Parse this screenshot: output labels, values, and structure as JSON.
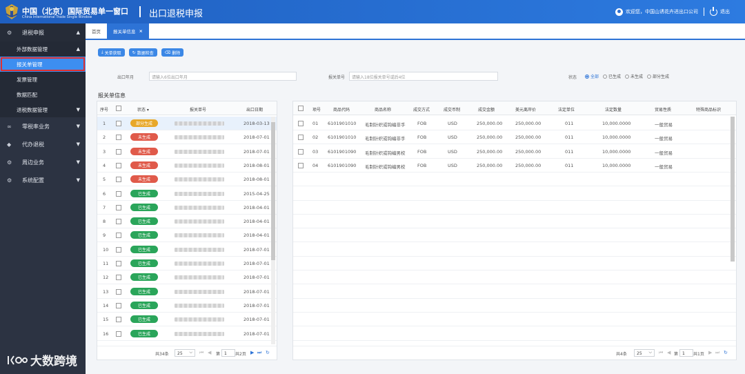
{
  "header": {
    "brand_cn": "中国（北京）国际贸易单一窗口",
    "brand_en": "China International Trade Single Window",
    "title": "出口退税申报",
    "welcome": "欢迎您，中国山诱花卉进出口公司",
    "logout": "退出"
  },
  "sidebar": {
    "items": [
      {
        "label": "退税申报",
        "icon": "gear-icon",
        "glyph": "⚙",
        "caret": "▲"
      },
      {
        "label": "零税率业务",
        "icon": "link-icon",
        "glyph": "∞",
        "caret": "▼"
      },
      {
        "label": "代办退税",
        "icon": "layers-icon",
        "glyph": "◆",
        "caret": "▼"
      },
      {
        "label": "周边业务",
        "icon": "gear-icon",
        "glyph": "⚙",
        "caret": "▼"
      },
      {
        "label": "系统配置",
        "icon": "gear-icon",
        "glyph": "⚙",
        "caret": "▼"
      }
    ],
    "sub": {
      "group": "外部数据管理",
      "group_caret": "▲",
      "children": [
        "报关单管理",
        "发票管理",
        "数据匹配"
      ],
      "group2": "退税数据管理",
      "group2_caret": "▼"
    },
    "watermark": "大数跨境"
  },
  "tabs": [
    {
      "label": "首页"
    },
    {
      "label": "报关单信息",
      "close": "×"
    }
  ],
  "toolbar": {
    "buttons": [
      {
        "glyph": "⤓",
        "label": "关单获取"
      },
      {
        "glyph": "↻",
        "label": "数据检查"
      },
      {
        "glyph": "⌫",
        "label": "删除"
      }
    ]
  },
  "filters": {
    "export_month_label": "出口年月",
    "export_month_placeholder": "请输入6位出口年月",
    "decl_no_label": "报关单号",
    "decl_no_placeholder": "请输入18位报关单号或后4位",
    "status_label": "状态",
    "status_options": [
      "全部",
      "已生成",
      "未生成",
      "部分生成"
    ],
    "status_selected": "全部"
  },
  "section_title": "报关单信息",
  "colors": {
    "partial": "#e8a82a",
    "ungenerated": "#e05a4a",
    "generated": "#2aa55a"
  },
  "left_table": {
    "headers": {
      "seq": "序号",
      "status": "状态 ▾",
      "decl_no": "报关单号",
      "export_date": "出口日期"
    },
    "rows": [
      {
        "seq": "1",
        "status": "部分生成",
        "status_type": "partial",
        "date": "2018-03-13"
      },
      {
        "seq": "2",
        "status": "未生成",
        "status_type": "ungenerated",
        "date": "2018-07-01"
      },
      {
        "seq": "3",
        "status": "未生成",
        "status_type": "ungenerated",
        "date": "2018-07-01"
      },
      {
        "seq": "4",
        "status": "未生成",
        "status_type": "ungenerated",
        "date": "2018-08-01"
      },
      {
        "seq": "5",
        "status": "未生成",
        "status_type": "ungenerated",
        "date": "2018-08-01"
      },
      {
        "seq": "6",
        "status": "已生成",
        "status_type": "generated",
        "date": "2015-04-25"
      },
      {
        "seq": "7",
        "status": "已生成",
        "status_type": "generated",
        "date": "2018-04-01"
      },
      {
        "seq": "8",
        "status": "已生成",
        "status_type": "generated",
        "date": "2018-04-01"
      },
      {
        "seq": "9",
        "status": "已生成",
        "status_type": "generated",
        "date": "2018-04-01"
      },
      {
        "seq": "10",
        "status": "已生成",
        "status_type": "generated",
        "date": "2018-07-01"
      },
      {
        "seq": "11",
        "status": "已生成",
        "status_type": "generated",
        "date": "2018-07-01"
      },
      {
        "seq": "12",
        "status": "已生成",
        "status_type": "generated",
        "date": "2018-07-01"
      },
      {
        "seq": "13",
        "status": "已生成",
        "status_type": "generated",
        "date": "2018-07-01"
      },
      {
        "seq": "14",
        "status": "已生成",
        "status_type": "generated",
        "date": "2018-07-01"
      },
      {
        "seq": "15",
        "status": "已生成",
        "status_type": "generated",
        "date": "2018-07-01"
      },
      {
        "seq": "16",
        "status": "已生成",
        "status_type": "generated",
        "date": "2018-07-01"
      }
    ],
    "pager": {
      "total": "共34条",
      "page_size": "25",
      "page_prefix": "第",
      "page": "1",
      "pages": "共2页"
    }
  },
  "right_table": {
    "headers": [
      "项号",
      "商品代码",
      "商品名称",
      "成交方式",
      "成交币制",
      "成交金额",
      "美元离岸价",
      "法定单位",
      "法定数量",
      "贸易性质",
      "特殊商品标识"
    ],
    "rows": [
      [
        "01",
        "6101901010",
        "毛制针织或钩编非手",
        "FOB",
        "USD",
        "250,000.00",
        "250,000.00",
        "011",
        "10,000.0000",
        "一般贸易",
        ""
      ],
      [
        "02",
        "6101901010",
        "毛制针织或钩编非手",
        "FOB",
        "USD",
        "250,000.00",
        "250,000.00",
        "011",
        "10,000.0000",
        "一般贸易",
        ""
      ],
      [
        "03",
        "6101901090",
        "毛制针织或钩编男校",
        "FOB",
        "USD",
        "250,000.00",
        "250,000.00",
        "011",
        "10,000.0000",
        "一般贸易",
        ""
      ],
      [
        "04",
        "6101901090",
        "毛制针织或钩编男校",
        "FOB",
        "USD",
        "250,000.00",
        "250,000.00",
        "011",
        "10,000.0000",
        "一般贸易",
        ""
      ]
    ],
    "pager": {
      "total": "共4条",
      "page_size": "25",
      "page_prefix": "第",
      "page": "1",
      "pages": "共1页"
    }
  }
}
